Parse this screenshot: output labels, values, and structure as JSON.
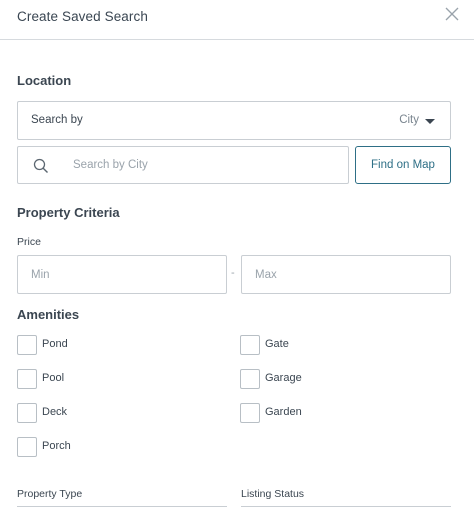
{
  "header": {
    "title": "Create Saved Search",
    "close_icon": "close-icon"
  },
  "location": {
    "heading": "Location",
    "search_by_label": "Search by",
    "search_by_value": "City",
    "search_placeholder": "Search by City",
    "find_on_map_label": "Find on Map"
  },
  "criteria": {
    "heading": "Property Criteria",
    "price_label": "Price",
    "price_min_placeholder": "Min",
    "price_separator": "-",
    "price_max_placeholder": "Max"
  },
  "amenities": {
    "heading": "Amenities",
    "items": [
      {
        "label": "Pond",
        "checked": false
      },
      {
        "label": "Gate",
        "checked": false
      },
      {
        "label": "Pool",
        "checked": false
      },
      {
        "label": "Garage",
        "checked": false
      },
      {
        "label": "Deck",
        "checked": false
      },
      {
        "label": "Garden",
        "checked": false
      },
      {
        "label": "Porch",
        "checked": false
      }
    ]
  },
  "bottom": {
    "property_type_label": "Property Type",
    "listing_status_label": "Listing Status"
  },
  "colors": {
    "accent": "#2e6f86",
    "border": "#c9ced3",
    "text": "#3b4651",
    "placeholder": "#9aa3ab"
  }
}
